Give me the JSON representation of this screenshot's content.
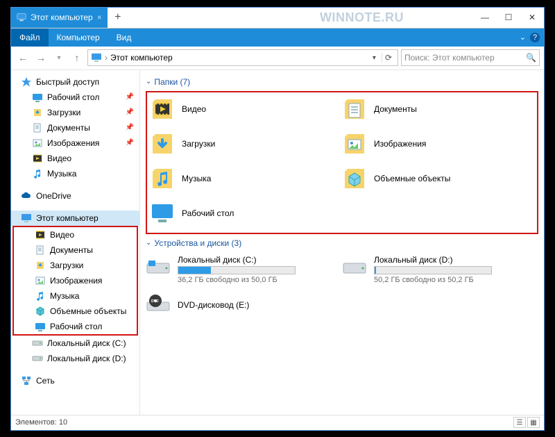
{
  "window": {
    "tab_title": "Этот компьютер",
    "new_tab_glyph": "+",
    "watermark": "WINNOTE.RU",
    "win_min": "—",
    "win_max": "☐",
    "win_close": "✕"
  },
  "ribbon": {
    "file": "Файл",
    "computer": "Компьютер",
    "view": "Вид",
    "expand_glyph": "⌄",
    "help_glyph": "?"
  },
  "nav": {
    "back_glyph": "←",
    "fwd_glyph": "→",
    "up_glyph": "↑",
    "sep_glyph": "›",
    "path": "Этот компьютер",
    "drop_glyph": "▾",
    "refresh_glyph": "⟳",
    "search_placeholder": "Поиск: Этот компьютер",
    "search_glyph": "🔍"
  },
  "sidebar": {
    "quick": {
      "label": "Быстрый доступ",
      "icon_color": "#3a9ae8"
    },
    "quick_items": [
      {
        "label": "Рабочий стол",
        "pin": "📌",
        "icon": "desktop"
      },
      {
        "label": "Загрузки",
        "pin": "📌",
        "icon": "downloads"
      },
      {
        "label": "Документы",
        "pin": "📌",
        "icon": "documents"
      },
      {
        "label": "Изображения",
        "pin": "📌",
        "icon": "pictures"
      },
      {
        "label": "Видео",
        "pin": "",
        "icon": "video"
      },
      {
        "label": "Музыка",
        "pin": "",
        "icon": "music"
      }
    ],
    "onedrive": "OneDrive",
    "this_pc": "Этот компьютер",
    "pc_items": [
      {
        "label": "Видео",
        "icon": "video"
      },
      {
        "label": "Документы",
        "icon": "documents"
      },
      {
        "label": "Загрузки",
        "icon": "downloads"
      },
      {
        "label": "Изображения",
        "icon": "pictures"
      },
      {
        "label": "Музыка",
        "icon": "music"
      },
      {
        "label": "Объемные объекты",
        "icon": "objects3d"
      },
      {
        "label": "Рабочий стол",
        "icon": "desktop"
      }
    ],
    "drive_c": "Локальный диск (C:)",
    "drive_d": "Локальный диск (D:)",
    "network": "Сеть"
  },
  "content": {
    "folders_header": "Папки (7)",
    "folders": [
      {
        "label": "Видео",
        "icon": "video"
      },
      {
        "label": "Документы",
        "icon": "documents"
      },
      {
        "label": "Загрузки",
        "icon": "downloads"
      },
      {
        "label": "Изображения",
        "icon": "pictures"
      },
      {
        "label": "Музыка",
        "icon": "music"
      },
      {
        "label": "Объемные объекты",
        "icon": "objects3d"
      },
      {
        "label": "Рабочий стол",
        "icon": "desktop"
      }
    ],
    "drives_header": "Устройства и диски (3)",
    "drive_c": {
      "label": "Локальный диск (C:)",
      "free": "36,2 ГБ свободно из 50,0 ГБ",
      "fill_pct": 28,
      "fill_color": "#2e9be6"
    },
    "drive_d": {
      "label": "Локальный диск (D:)",
      "free": "50,2 ГБ свободно из 50,2 ГБ",
      "fill_pct": 1,
      "fill_color": "#2e9be6"
    },
    "dvd": {
      "label": "DVD-дисковод (E:)"
    }
  },
  "status": {
    "count": "Элементов: 10"
  }
}
